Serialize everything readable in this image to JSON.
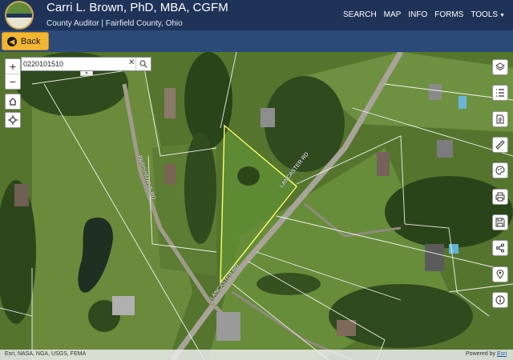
{
  "header": {
    "title": "Carri L. Brown, PhD, MBA, CGFM",
    "subtitle": "County Auditor | Fairfield County, Ohio",
    "logo_text": "FAIRFIELD"
  },
  "nav": {
    "items": [
      "SEARCH",
      "MAP",
      "INFO",
      "FORMS",
      "TOOLS"
    ]
  },
  "back_button": {
    "label": "Back"
  },
  "search": {
    "value": "0220101510"
  },
  "map": {
    "road_labels": [
      "PARISHMANS RD",
      "LANCASTER RD",
      "LANCASTER RD"
    ],
    "selected_parcel_color": "#ffff66",
    "parcel_line_color": "#ffffff"
  },
  "attribution": {
    "left": "Esri, NASA, NGA, USGS, FEMA",
    "powered_by": "Powered by ",
    "powered_link": "Esri"
  },
  "colors": {
    "header_bg": "#1f3358",
    "subbar_bg": "#2c4a78",
    "accent": "#f2b632"
  }
}
